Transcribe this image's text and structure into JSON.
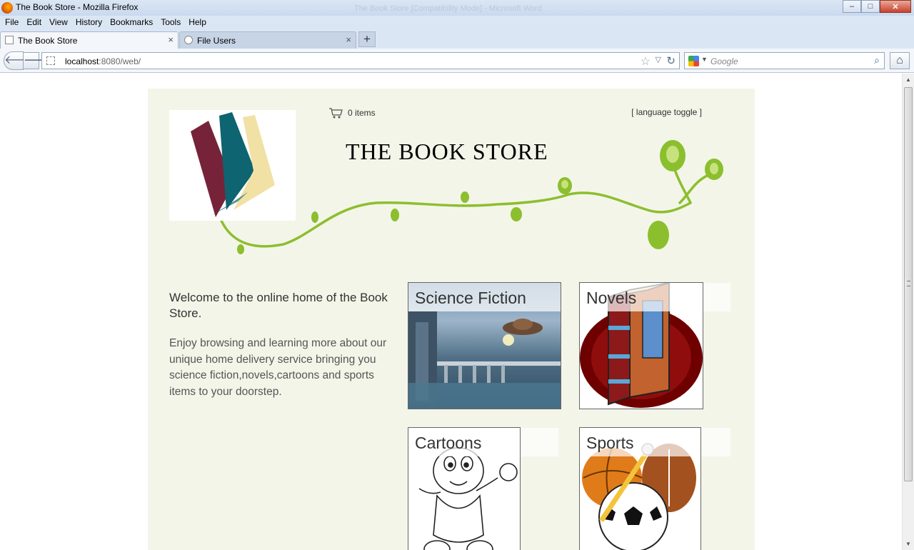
{
  "window": {
    "title": "The Book Store - Mozilla Firefox",
    "background_title": "The Book Store [Compatibility Mode] - Microsoft Word",
    "controls": {
      "minimize": "‒",
      "maximize": "□",
      "close": "✕"
    }
  },
  "menu": [
    "File",
    "Edit",
    "View",
    "History",
    "Bookmarks",
    "Tools",
    "Help"
  ],
  "tabs": [
    {
      "label": "The Book Store",
      "close": "×"
    },
    {
      "label": "File Users",
      "close": "×"
    }
  ],
  "new_tab": "+",
  "nav": {
    "back": "🡐",
    "forward": "🡒",
    "url_host": "localhost",
    "url_rest": ":8080/web/",
    "star": "☆",
    "dropdown": "▽",
    "reload": "↻",
    "search_placeholder": "Google",
    "search_go": "⌕",
    "home": "⌂"
  },
  "scrollbar": {
    "up": "▲",
    "down": "▼"
  },
  "page": {
    "cart_text": "0 items",
    "language_toggle": "[ language toggle ]",
    "store_title": "THE BOOK STORE",
    "welcome": "Welcome to the online home of the Book Store.",
    "intro": "Enjoy browsing and learning more about our unique home delivery service bringing you science fiction,novels,cartoons and sports items to your doorstep.",
    "categories": [
      "Science Fiction",
      "Novels",
      "Cartoons",
      "Sports"
    ]
  },
  "colors": {
    "page_bg": "#f4f5e9",
    "vine": "#8bbf2e",
    "logo_maroon": "#76233a",
    "logo_teal": "#0e6470",
    "logo_cream": "#f2e1a4"
  }
}
